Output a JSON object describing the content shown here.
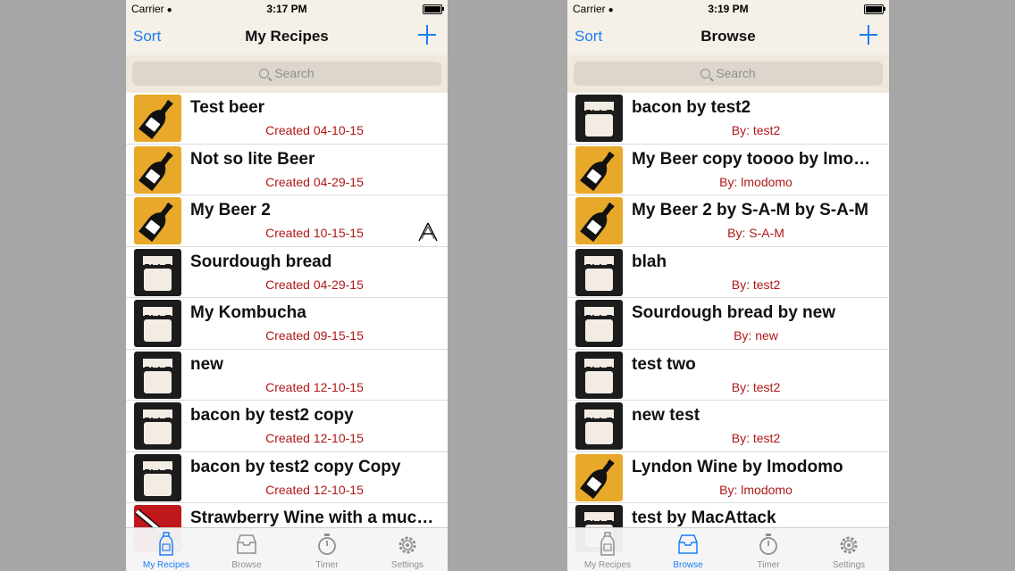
{
  "colors": {
    "accent": "#1a7ff5",
    "subtitle": "#b01818",
    "bar_background": "#f5f0e8"
  },
  "left_screen": {
    "status": {
      "carrier": "Carrier",
      "time": "3:17 PM"
    },
    "nav": {
      "left_button": "Sort",
      "title": "My Recipes",
      "right_icon": "plus-icon"
    },
    "search": {
      "placeholder": "Search"
    },
    "rows": [
      {
        "name": "Test beer",
        "subtitle": "Created 04-10-15",
        "icon": "beer-bottle-icon"
      },
      {
        "name": "Not so lite Beer",
        "subtitle": "Created 04-29-15",
        "icon": "beer-bottle-icon"
      },
      {
        "name": "My Beer 2",
        "subtitle": "Created 10-15-15",
        "icon": "beer-bottle-icon",
        "accessory": "shared-a-icon"
      },
      {
        "name": "Sourdough bread",
        "subtitle": "Created 04-29-15",
        "icon": "jar-icon"
      },
      {
        "name": "My Kombucha",
        "subtitle": "Created 09-15-15",
        "icon": "jar-icon"
      },
      {
        "name": "new",
        "subtitle": "Created 12-10-15",
        "icon": "jar-icon"
      },
      {
        "name": "bacon by test2 copy",
        "subtitle": "Created 12-10-15",
        "icon": "jar-icon"
      },
      {
        "name": "bacon by test2 copy Copy",
        "subtitle": "Created 12-10-15",
        "icon": "jar-icon"
      },
      {
        "name": "Strawberry Wine with a muc…",
        "subtitle": "",
        "icon": "wine-bottle-icon"
      }
    ],
    "tabs": [
      {
        "label": "My Recipes",
        "icon": "bottle-tab-icon",
        "active": true
      },
      {
        "label": "Browse",
        "icon": "inbox-tab-icon",
        "active": false
      },
      {
        "label": "Timer",
        "icon": "stopwatch-tab-icon",
        "active": false
      },
      {
        "label": "Settings",
        "icon": "gear-tab-icon",
        "active": false
      }
    ]
  },
  "right_screen": {
    "status": {
      "carrier": "Carrier",
      "time": "3:19 PM"
    },
    "nav": {
      "left_button": "Sort",
      "title": "Browse",
      "right_icon": "plus-icon"
    },
    "search": {
      "placeholder": "Search"
    },
    "rows": [
      {
        "name": "bacon by test2",
        "subtitle": "By: test2",
        "icon": "jar-icon"
      },
      {
        "name": "My Beer copy toooo by lmo…",
        "subtitle": "By: lmodomo",
        "icon": "beer-bottle-icon"
      },
      {
        "name": "My Beer 2 by S-A-M by S-A-M",
        "subtitle": "By: S-A-M",
        "icon": "beer-bottle-icon"
      },
      {
        "name": "blah",
        "subtitle": "By: test2",
        "icon": "jar-icon"
      },
      {
        "name": "Sourdough bread by new",
        "subtitle": "By: new",
        "icon": "jar-icon"
      },
      {
        "name": "test two",
        "subtitle": "By: test2",
        "icon": "jar-icon"
      },
      {
        "name": "new test",
        "subtitle": "By: test2",
        "icon": "jar-icon"
      },
      {
        "name": "Lyndon Wine by lmodomo",
        "subtitle": "By: lmodomo",
        "icon": "beer-bottle-icon"
      },
      {
        "name": "test by MacAttack",
        "subtitle": "",
        "icon": "jar-icon"
      }
    ],
    "tabs": [
      {
        "label": "My Recipes",
        "icon": "bottle-tab-icon",
        "active": false
      },
      {
        "label": "Browse",
        "icon": "inbox-tab-icon",
        "active": true
      },
      {
        "label": "Timer",
        "icon": "stopwatch-tab-icon",
        "active": false
      },
      {
        "label": "Settings",
        "icon": "gear-tab-icon",
        "active": false
      }
    ]
  }
}
